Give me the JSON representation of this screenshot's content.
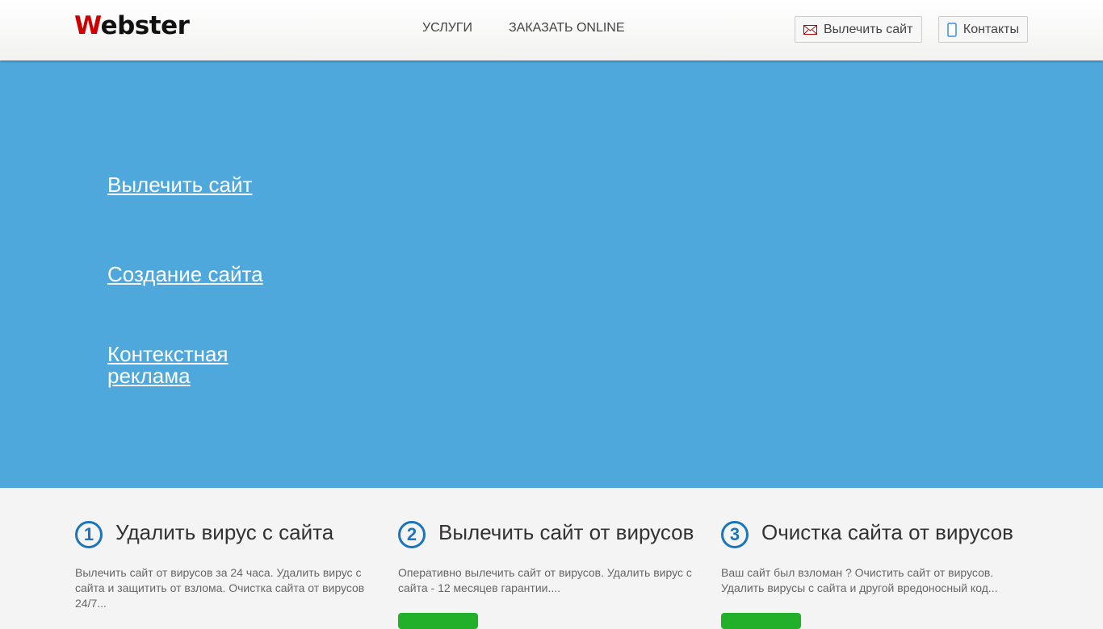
{
  "header": {
    "logo_first": "W",
    "logo_rest": "ebster",
    "nav": [
      "УСЛУГИ",
      "ЗАКАЗАТЬ ONLINE"
    ],
    "cure_button": "Вылечить сайт",
    "contacts_button": "Контакты"
  },
  "hero": {
    "links": [
      "Вылечить сайт",
      "Создание сайта",
      "Контекстная реклама"
    ]
  },
  "features": [
    {
      "num": "1",
      "title": "Удалить вирус с сайта",
      "text": "Вылечить сайт от вирусов за 24 часа. Удалить вирус с сайта и защитить от взлома. Очистка сайта от вирусов 24/7..."
    },
    {
      "num": "2",
      "title": "Вылечить сайт от вирусов",
      "text": "Оперативно вылечить сайт от вирусов. Удалить вирус с сайта - 12 месяцев гарантии...."
    },
    {
      "num": "3",
      "title": "Очистка сайта от вирусов",
      "text": "Ваш сайт был взломан ? Очистить сайт от вирусов. Удалить вирусы с сайта и другой вредоносный код..."
    }
  ],
  "colors": {
    "accent": "#1b75bb",
    "hero": "#4fa8dc",
    "button": "#22b02a"
  }
}
